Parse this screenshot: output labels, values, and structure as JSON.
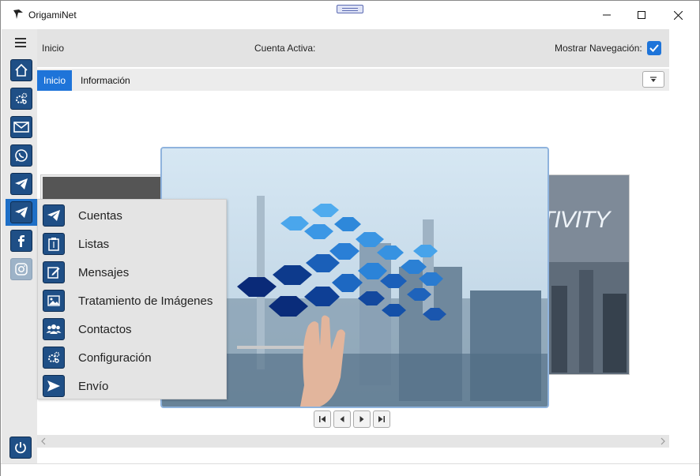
{
  "window": {
    "title": "OrigamiNet",
    "controls": [
      "minimize-icon",
      "maximize-icon",
      "close-icon"
    ]
  },
  "sidebar": {
    "menu_icon": "hamburger-icon",
    "items": [
      {
        "name": "home",
        "icon": "home-icon"
      },
      {
        "name": "settings",
        "icon": "gears-icon"
      },
      {
        "name": "email",
        "icon": "envelope-icon"
      },
      {
        "name": "whatsapp",
        "icon": "whatsapp-icon"
      },
      {
        "name": "telegram",
        "icon": "telegram-icon"
      },
      {
        "name": "telegram-active",
        "icon": "telegram-icon"
      },
      {
        "name": "facebook",
        "icon": "facebook-icon"
      },
      {
        "name": "instagram",
        "icon": "instagram-icon"
      }
    ],
    "power_icon": "power-icon"
  },
  "topbar": {
    "breadcrumb": "Inicio",
    "account_label": "Cuenta Activa:",
    "show_nav_label": "Mostrar Navegación:",
    "show_nav_checked": true
  },
  "tabs": [
    {
      "label": "Inicio",
      "active": true
    },
    {
      "label": "Información",
      "active": false
    }
  ],
  "carousel": {
    "right_caption": "TIVITY",
    "pager": [
      "first-icon",
      "prev-icon",
      "next-icon",
      "last-icon"
    ]
  },
  "flyout": {
    "items": [
      {
        "label": "Cuentas",
        "icon": "telegram-icon"
      },
      {
        "label": "Listas",
        "icon": "clipboard-icon"
      },
      {
        "label": "Mensajes",
        "icon": "edit-icon"
      },
      {
        "label": "Tratamiento de Imágenes",
        "icon": "image-icon"
      },
      {
        "label": "Contactos",
        "icon": "contacts-icon"
      },
      {
        "label": "Configuración",
        "icon": "gears-icon"
      },
      {
        "label": "Envío",
        "icon": "send-icon"
      }
    ]
  },
  "colors": {
    "accent": "#1e74d9",
    "icon_bg": "#1f4f86",
    "sidebar_bg": "#e8e8e8"
  }
}
